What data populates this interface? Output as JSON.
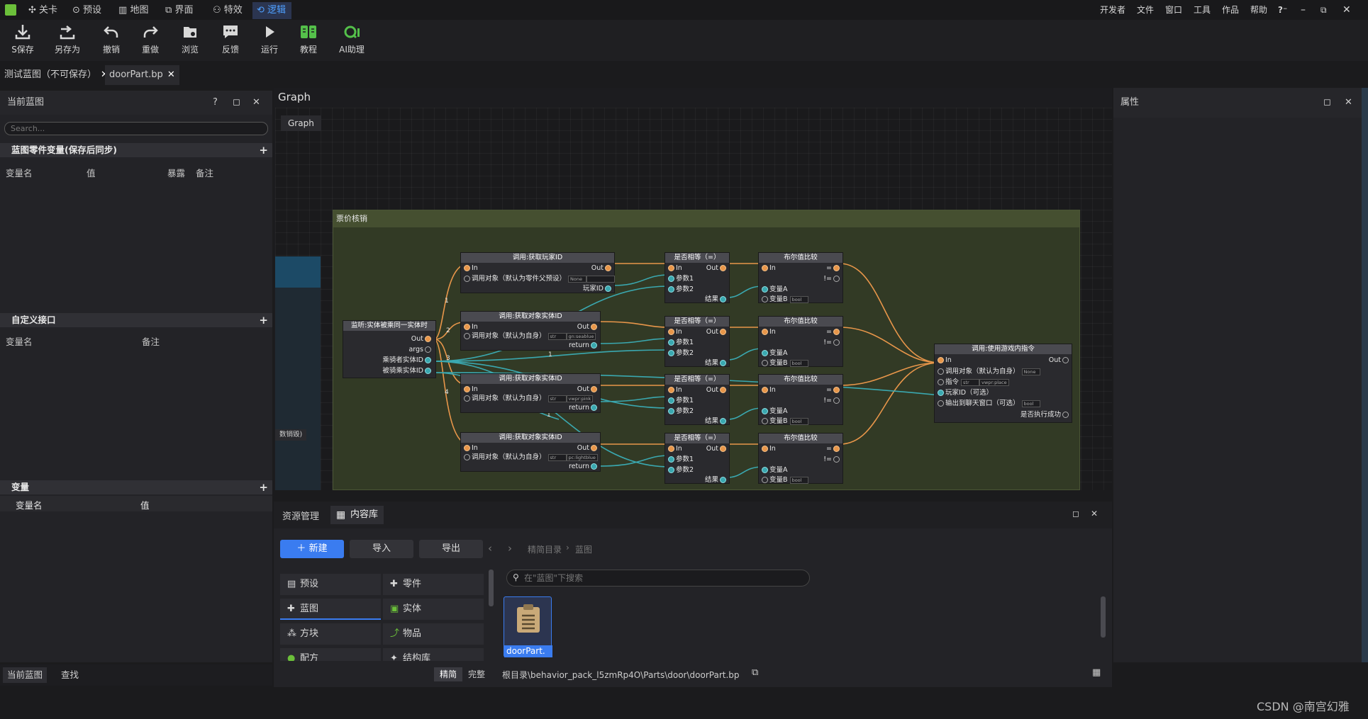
{
  "menubar": {
    "tabs": [
      {
        "label": "关卡",
        "icon": "level-icon"
      },
      {
        "label": "预设",
        "icon": "preset-icon"
      },
      {
        "label": "地图",
        "icon": "map-icon"
      },
      {
        "label": "界面",
        "icon": "ui-icon"
      },
      {
        "label": "特效",
        "icon": "effects-icon"
      },
      {
        "label": "逻辑",
        "icon": "logic-icon"
      }
    ],
    "right": [
      "开发者",
      "文件",
      "窗口",
      "工具",
      "作品",
      "帮助"
    ],
    "accent": "#4ea0ff"
  },
  "toolbar": {
    "items": [
      {
        "label": "S保存",
        "icon": "save-icon"
      },
      {
        "label": "另存为",
        "icon": "save-as-icon"
      },
      {
        "label": "撤销",
        "icon": "undo-icon"
      },
      {
        "label": "重做",
        "icon": "redo-icon"
      },
      {
        "label": "浏览",
        "icon": "browse-icon"
      },
      {
        "label": "反馈",
        "icon": "feedback-icon"
      },
      {
        "label": "运行",
        "icon": "run-icon"
      },
      {
        "label": "教程",
        "icon": "tutorial-icon"
      },
      {
        "label": "AI助理",
        "icon": "ai-assistant-icon"
      }
    ]
  },
  "doc_tabs": [
    {
      "label": "测试蓝图（不可保存）"
    },
    {
      "label": "doorPart.bp"
    }
  ],
  "left_panel": {
    "title": "当前蓝图",
    "search_placeholder": "Search...",
    "sections": {
      "part_vars": {
        "title": "蓝图零件变量(保存后同步)",
        "cols": [
          "变量名",
          "值",
          "暴露",
          "备注"
        ]
      },
      "custom_iface": {
        "title": "自定义接口",
        "cols": [
          "变量名",
          "备注"
        ]
      },
      "vars": {
        "title": "变量",
        "cols": [
          "变量名",
          "值"
        ]
      }
    },
    "bottom_tabs": [
      "当前蓝图",
      "查找"
    ]
  },
  "graph": {
    "title": "Graph",
    "breadcrumb": "Graph",
    "comment_title": "票价核销",
    "left_stub_label": "数销毁)",
    "event_node": {
      "title": "监听:实体被乘同一实体时",
      "pins": [
        "Out",
        "args",
        "乘骑者实体ID",
        "被骑乘实体ID"
      ]
    },
    "wire_labels": [
      "1",
      "2",
      "3",
      "4",
      "1",
      "1"
    ],
    "get_player": {
      "title": "调用:获取玩家ID",
      "in": "In",
      "target": "调用对象（默认为零件父预设）",
      "target_val": "None",
      "out": "Out",
      "ret": "玩家ID"
    },
    "get_entity_nodes": [
      {
        "title": "调用:获取对象实体ID",
        "in": "In",
        "target": "调用对象（默认为自身）",
        "val1": "str",
        "val2": "gn:seablue",
        "out": "Out",
        "ret": "return"
      },
      {
        "title": "调用:获取对象实体ID",
        "in": "In",
        "target": "调用对象（默认为自身）",
        "val1": "str",
        "val2": "vwpr:pink",
        "out": "Out",
        "ret": "return"
      },
      {
        "title": "调用:获取对象实体ID",
        "in": "In",
        "target": "调用对象（默认为自身）",
        "val1": "str",
        "val2": "pc:lightblue",
        "out": "Out",
        "ret": "return"
      }
    ],
    "equal_nodes": [
      {
        "title": "是否相等（=）",
        "in": "In",
        "out": "Out",
        "a": "参数1",
        "b": "参数2",
        "ret": "结果"
      },
      {
        "title": "是否相等（=）",
        "in": "In",
        "out": "Out",
        "a": "参数1",
        "b": "参数2",
        "ret": "结果"
      },
      {
        "title": "是否相等（=）",
        "in": "In",
        "out": "Out",
        "a": "参数1",
        "b": "参数2",
        "ret": "结果"
      },
      {
        "title": "是否相等（=）",
        "in": "In",
        "out": "Out",
        "a": "参数1",
        "b": "参数2",
        "ret": "结果"
      }
    ],
    "bool_nodes": [
      {
        "title": "布尔值比较",
        "in": "In",
        "eq": "=",
        "ne": "!=",
        "a": "变量A",
        "b": "变量B",
        "bval": "bool"
      },
      {
        "title": "布尔值比较",
        "in": "In",
        "eq": "=",
        "ne": "!=",
        "a": "变量A",
        "b": "变量B",
        "bval": "bool"
      },
      {
        "title": "布尔值比较",
        "in": "In",
        "eq": "=",
        "ne": "!=",
        "a": "变量A",
        "b": "变量B",
        "bval": "bool"
      },
      {
        "title": "布尔值比较",
        "in": "In",
        "eq": "=",
        "ne": "!=",
        "a": "变量A",
        "b": "变量B",
        "bval": "bool"
      }
    ],
    "cmd_node": {
      "title": "调用:使用游戏内指令",
      "in": "In",
      "out": "Out",
      "target": "调用对象（默认为自身）",
      "target_val": "None",
      "cmd": "指令",
      "cmd_val1": "str",
      "cmd_val2": "vwpr:place",
      "player": "玩家ID（可选）",
      "chat": "输出到聊天窗口（可选）",
      "chat_val": "bool",
      "ret": "是否执行成功"
    }
  },
  "right_panel": {
    "title": "属性"
  },
  "content_browser": {
    "tabs": [
      "资源管理",
      "内容库"
    ],
    "new_label": "新建",
    "import_label": "导入",
    "export_label": "导出",
    "breadcrumb": [
      "精简目录",
      "蓝图"
    ],
    "search_placeholder": "在\"蓝图\"下搜索",
    "categories": [
      "预设",
      "零件",
      "蓝图",
      "实体",
      "方块",
      "物品",
      "配方",
      "结构库"
    ],
    "mode_buttons": [
      "精简",
      "完整"
    ],
    "file_name": "doorPart.",
    "path": "根目录\\behavior_pack_l5zmRp4O\\Parts\\door\\doorPart.bp"
  },
  "watermark": "CSDN @南宫幻雅",
  "colors": {
    "accent": "#3a7cf0",
    "exec_wire": "#e8964a",
    "data_wire": "#3aa8b0",
    "comment_bg": "#323a25"
  }
}
